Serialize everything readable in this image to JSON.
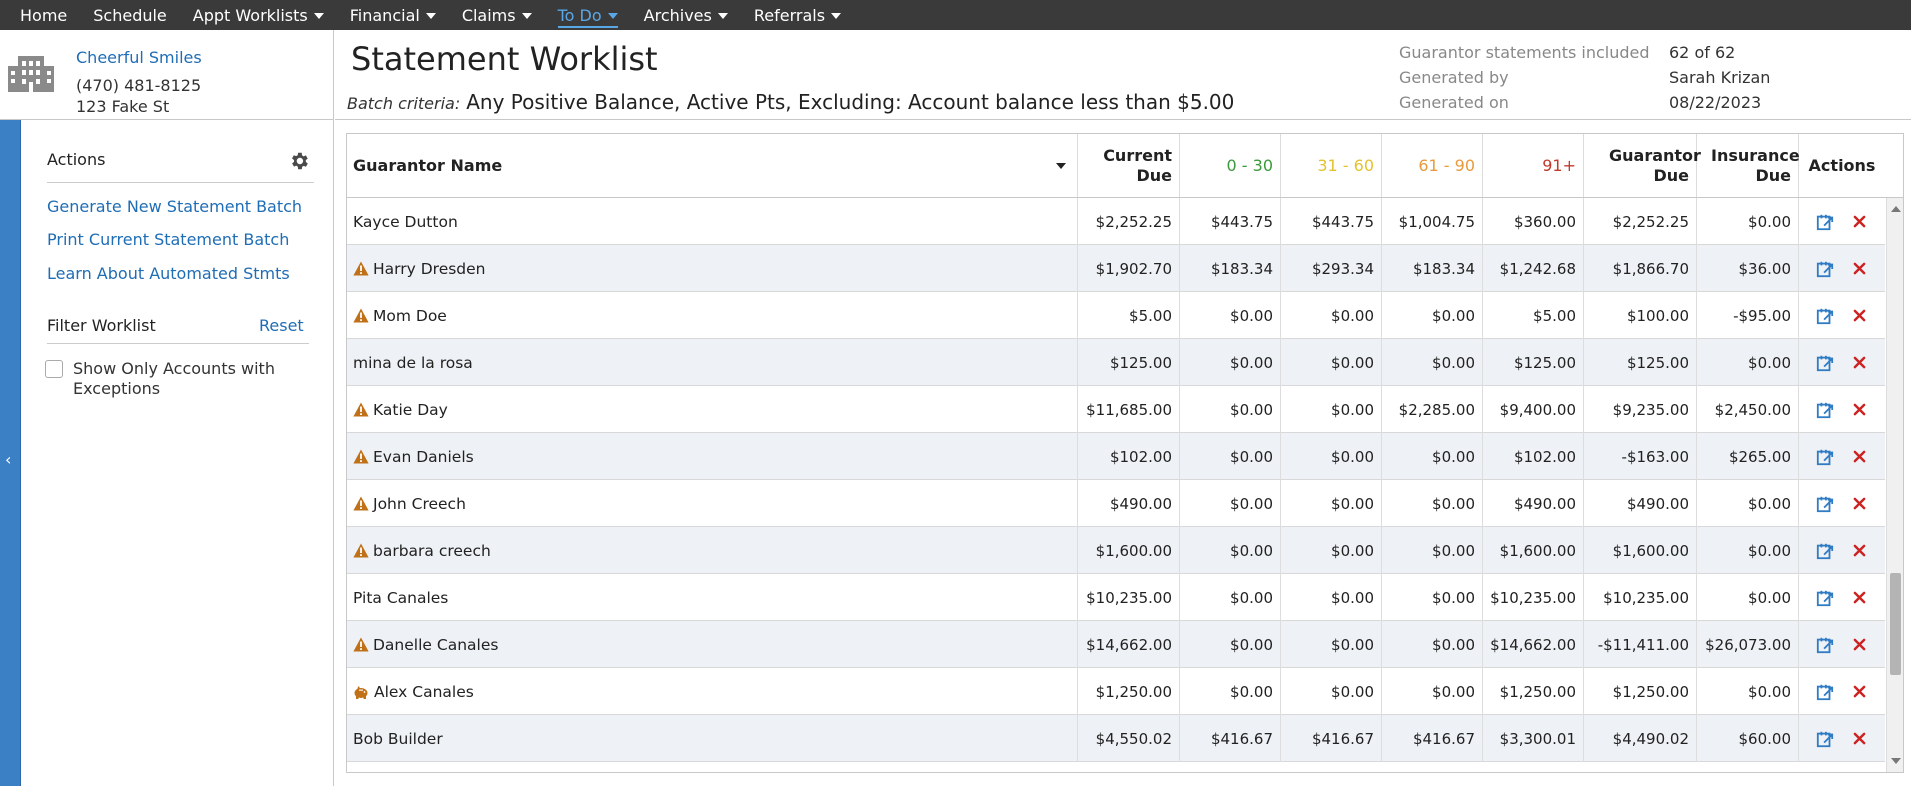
{
  "nav": [
    {
      "label": "Home",
      "caret": false,
      "active": false
    },
    {
      "label": "Schedule",
      "caret": false,
      "active": false
    },
    {
      "label": "Appt Worklists",
      "caret": true,
      "active": false
    },
    {
      "label": "Financial",
      "caret": true,
      "active": false
    },
    {
      "label": "Claims",
      "caret": true,
      "active": false
    },
    {
      "label": "To Do",
      "caret": true,
      "active": true
    },
    {
      "label": "Archives",
      "caret": true,
      "active": false
    },
    {
      "label": "Referrals",
      "caret": true,
      "active": false
    }
  ],
  "practice": {
    "name": "Cheerful Smiles",
    "phone": "(470) 481-8125",
    "address": "123 Fake St"
  },
  "sidebar": {
    "actions_title": "Actions",
    "links": [
      "Generate New Statement Batch",
      "Print Current Statement Batch",
      "Learn About Automated Stmts"
    ],
    "filter_title": "Filter Worklist",
    "reset_label": "Reset",
    "checkbox_label": "Show Only Accounts with Exceptions",
    "checkbox_checked": false
  },
  "header": {
    "title": "Statement Worklist",
    "batch_label": "Batch criteria:",
    "batch_value": "Any Positive Balance, Active Pts, Excluding: Account balance less than $5.00",
    "meta": [
      {
        "label": "Guarantor statements included",
        "value": "62 of 62"
      },
      {
        "label": "Generated by",
        "value": "Sarah Krizan"
      },
      {
        "label": "Generated on",
        "value": "08/22/2023"
      }
    ]
  },
  "table": {
    "columns": [
      {
        "key": "name",
        "label": "Guarantor Name"
      },
      {
        "key": "current",
        "label": "Current Due"
      },
      {
        "key": "b0",
        "label": "0 - 30"
      },
      {
        "key": "b1",
        "label": "31 - 60"
      },
      {
        "key": "b2",
        "label": "61 - 90"
      },
      {
        "key": "b3",
        "label": "91+"
      },
      {
        "key": "guar",
        "label": "Guarantor Due"
      },
      {
        "key": "ins",
        "label": "Insurance Due"
      },
      {
        "key": "actions",
        "label": "Actions"
      }
    ],
    "rows": [
      {
        "flag": "",
        "name": "Kayce Dutton",
        "current": "$2,252.25",
        "b0": "$443.75",
        "b1": "$443.75",
        "b2": "$1,004.75",
        "b3": "$360.00",
        "guar": "$2,252.25",
        "ins": "$0.00"
      },
      {
        "flag": "warn",
        "name": "Harry Dresden",
        "current": "$1,902.70",
        "b0": "$183.34",
        "b1": "$293.34",
        "b2": "$183.34",
        "b3": "$1,242.68",
        "guar": "$1,866.70",
        "ins": "$36.00"
      },
      {
        "flag": "warn",
        "name": "Mom Doe",
        "current": "$5.00",
        "b0": "$0.00",
        "b1": "$0.00",
        "b2": "$0.00",
        "b3": "$5.00",
        "guar": "$100.00",
        "ins": "-$95.00"
      },
      {
        "flag": "",
        "name": "mina de la rosa",
        "current": "$125.00",
        "b0": "$0.00",
        "b1": "$0.00",
        "b2": "$0.00",
        "b3": "$125.00",
        "guar": "$125.00",
        "ins": "$0.00"
      },
      {
        "flag": "warn",
        "name": "Katie Day",
        "current": "$11,685.00",
        "b0": "$0.00",
        "b1": "$0.00",
        "b2": "$2,285.00",
        "b3": "$9,400.00",
        "guar": "$9,235.00",
        "ins": "$2,450.00"
      },
      {
        "flag": "warn",
        "name": "Evan Daniels",
        "current": "$102.00",
        "b0": "$0.00",
        "b1": "$0.00",
        "b2": "$0.00",
        "b3": "$102.00",
        "guar": "-$163.00",
        "ins": "$265.00"
      },
      {
        "flag": "warn",
        "name": "John Creech",
        "current": "$490.00",
        "b0": "$0.00",
        "b1": "$0.00",
        "b2": "$0.00",
        "b3": "$490.00",
        "guar": "$490.00",
        "ins": "$0.00"
      },
      {
        "flag": "warn",
        "name": "barbara creech",
        "current": "$1,600.00",
        "b0": "$0.00",
        "b1": "$0.00",
        "b2": "$0.00",
        "b3": "$1,600.00",
        "guar": "$1,600.00",
        "ins": "$0.00"
      },
      {
        "flag": "",
        "name": "Pita Canales",
        "current": "$10,235.00",
        "b0": "$0.00",
        "b1": "$0.00",
        "b2": "$0.00",
        "b3": "$10,235.00",
        "guar": "$10,235.00",
        "ins": "$0.00"
      },
      {
        "flag": "warn",
        "name": "Danelle Canales",
        "current": "$14,662.00",
        "b0": "$0.00",
        "b1": "$0.00",
        "b2": "$0.00",
        "b3": "$14,662.00",
        "guar": "-$11,411.00",
        "ins": "$26,073.00"
      },
      {
        "flag": "piggy",
        "name": "Alex Canales",
        "current": "$1,250.00",
        "b0": "$0.00",
        "b1": "$0.00",
        "b2": "$0.00",
        "b3": "$1,250.00",
        "guar": "$1,250.00",
        "ins": "$0.00"
      },
      {
        "flag": "",
        "name": "Bob Builder",
        "current": "$4,550.02",
        "b0": "$416.67",
        "b1": "$416.67",
        "b2": "$416.67",
        "b3": "$3,300.01",
        "guar": "$4,490.02",
        "ins": "$60.00"
      }
    ]
  },
  "colors": {
    "link": "#1f6db5",
    "nav_bg": "#3a3a3a",
    "nav_active": "#5aa7e6",
    "warn": "#c07016",
    "delete": "#cc2222",
    "action_icon": "#2f7bc4"
  }
}
